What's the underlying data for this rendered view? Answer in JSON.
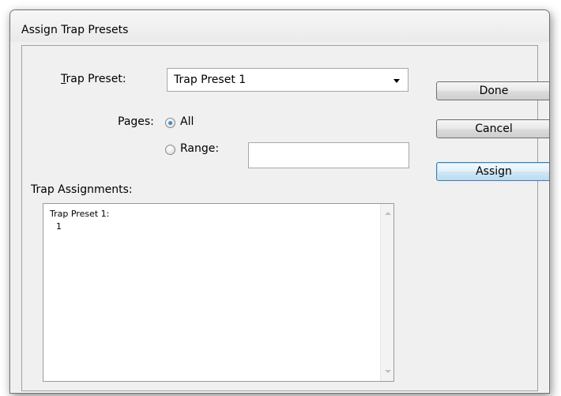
{
  "window": {
    "title": "Assign Trap Presets"
  },
  "form": {
    "trap_preset_label": "Trap Preset:",
    "trap_preset_value": "Trap Preset 1",
    "pages_label": "Pages:",
    "radio_all_label": "All",
    "radio_range_label": "Range:",
    "range_value": "",
    "selected_pages_option": "All",
    "trap_assignments_label": "Trap Assignments:"
  },
  "assignments": {
    "line1": "Trap Preset 1:",
    "line2": "1"
  },
  "buttons": {
    "done": "Done",
    "cancel": "Cancel",
    "assign": "Assign"
  },
  "colors": {
    "dialog_background": "#f0f0f0",
    "default_button_border": "#3c7fb1",
    "radio_selected": "#1c5a9a"
  },
  "icons": {
    "dropdown": "chevron-down-icon",
    "scroll_up": "scroll-up-icon",
    "scroll_down": "scroll-down-icon"
  }
}
